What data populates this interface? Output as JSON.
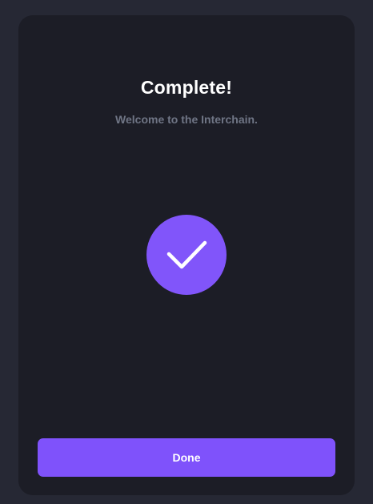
{
  "dialog": {
    "title": "Complete!",
    "subtitle": "Welcome to the Interchain.",
    "status_icon": "checkmark-icon",
    "done_label": "Done"
  },
  "colors": {
    "page_background": "#262834",
    "card_background": "#1c1d26",
    "accent": "#7f52fb",
    "subtitle_text": "#6f7585"
  }
}
